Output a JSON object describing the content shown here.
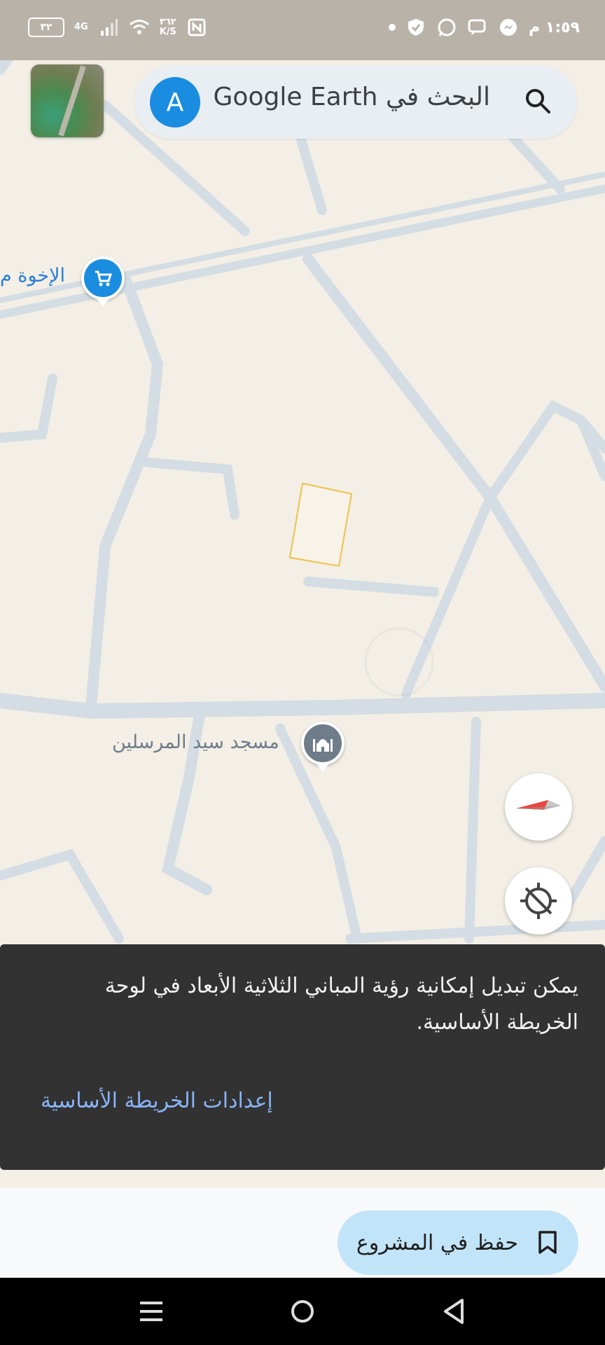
{
  "status_bar": {
    "time": "١:٥٩ م",
    "battery": "٣٢",
    "network": "4G",
    "speed_value": "٣٦٢",
    "speed_unit": "K/S",
    "icons": [
      "dot-icon",
      "shield-icon",
      "whatsapp-icon",
      "chat-icon",
      "messenger-icon",
      "nfc-icon",
      "wifi-icon",
      "signal-icon"
    ]
  },
  "search": {
    "avatar_letter": "A",
    "placeholder": "البحث في Google Earth"
  },
  "map": {
    "place_shop_label": "الإخوة م",
    "place_mosque_label": "مسجد سيد المرسلين",
    "colors": {
      "background": "#f3efe6",
      "road": "#d4dde3",
      "pin_blue": "#1a8de0",
      "pin_gray": "#6f7c8a",
      "parcel_outline": "#f0c14b"
    }
  },
  "snackbar": {
    "message": "يمكن تبديل إمكانية رؤية المباني الثلاثية الأبعاد في لوحة الخريطة الأساسية.",
    "action_label": "إعدادات الخريطة الأساسية"
  },
  "bottom": {
    "save_label": "حفظ في المشروع"
  }
}
